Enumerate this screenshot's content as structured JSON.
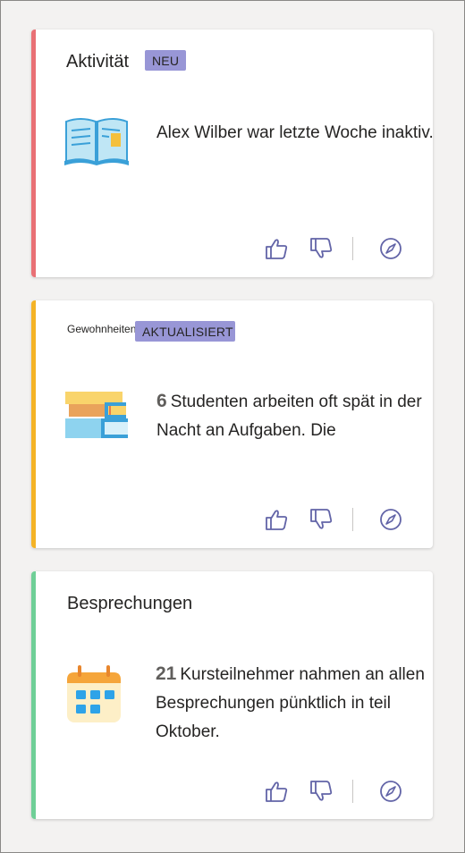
{
  "colors": {
    "accent_activity": "#e97075",
    "accent_habits": "#f4b326",
    "accent_meetings": "#6fcf97",
    "badge": "#9896d6",
    "icon_stroke": "#6264a7"
  },
  "cards": [
    {
      "title": "Aktivität",
      "badge": "NEU",
      "number": "",
      "text": "Alex Wilber war letzte Woche inaktiv.",
      "illustration": "open-book-icon"
    },
    {
      "title": "Gewohnheiten",
      "badge": "AKTUALISIERT",
      "number": "6",
      "text": "Studenten arbeiten oft spät in der Nacht an Aufgaben. Die",
      "illustration": "book-stack-icon"
    },
    {
      "title": "Besprechungen",
      "badge": "",
      "number": "21",
      "text": "Kursteilnehmer nahmen an allen Besprechungen pünktlich in teil Oktober.",
      "illustration": "calendar-icon"
    }
  ],
  "actions": {
    "like_icon": "thumbs-up-icon",
    "dislike_icon": "thumbs-down-icon",
    "explore_icon": "compass-icon"
  }
}
